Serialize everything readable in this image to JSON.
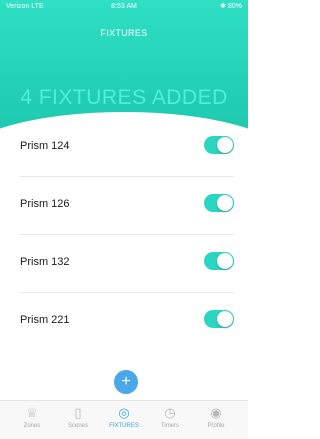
{
  "status": {
    "carrier": "Verizon LTE",
    "time": "8:53 AM",
    "battery": "80%"
  },
  "header": {
    "title": "FIXTURES",
    "summary": "4 FIXTURES ADDED"
  },
  "fixtures": [
    {
      "name": "Prism 124",
      "on": true
    },
    {
      "name": "Prism 126",
      "on": true
    },
    {
      "name": "Prism 132",
      "on": true
    },
    {
      "name": "Prism 221",
      "on": true
    }
  ],
  "fab": {
    "label": "+"
  },
  "tabs": [
    {
      "label": "Zones",
      "icon": "crown-icon",
      "glyph": "♕"
    },
    {
      "label": "Scenes",
      "icon": "door-icon",
      "glyph": "▯"
    },
    {
      "label": "FIXTURES",
      "icon": "target-icon",
      "glyph": "◎"
    },
    {
      "label": "Timers",
      "icon": "timer-icon",
      "glyph": "◷"
    },
    {
      "label": "Profile",
      "icon": "profile-icon",
      "glyph": "◉"
    }
  ],
  "colors": {
    "accent": "#2fe0c4",
    "toggle": "#2bd6c0",
    "active_tab": "#3aa7e8",
    "fab": "#4aa8e8"
  }
}
